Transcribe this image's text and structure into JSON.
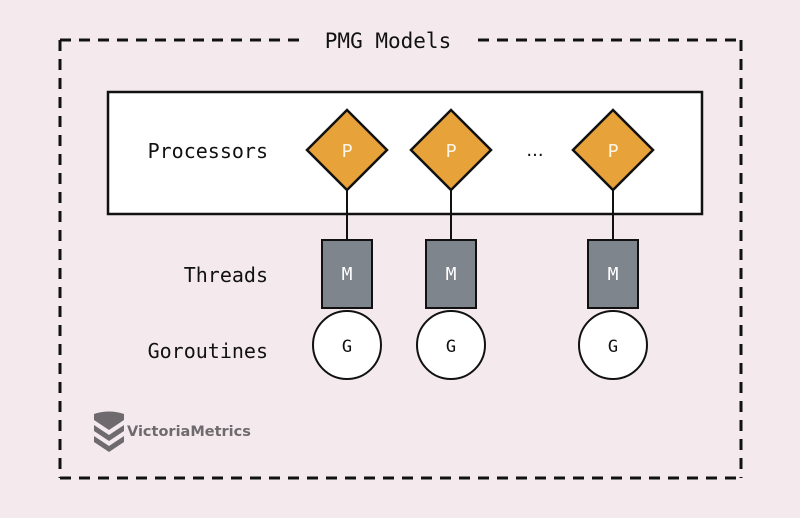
{
  "diagram": {
    "title": "PMG Models",
    "rows": {
      "processors": "Processors",
      "threads": "Threads",
      "goroutines": "Goroutines"
    },
    "columns": [
      {
        "processor": "P",
        "thread": "M",
        "goroutine": "G"
      },
      {
        "processor": "P",
        "thread": "M",
        "goroutine": "G"
      },
      {
        "processor": "P",
        "thread": "M",
        "goroutine": "G"
      }
    ],
    "ellipsis": "...",
    "colors": {
      "background": "#f4eaee",
      "processor_fill": "#e8a23a",
      "thread_fill": "#7e858d",
      "goroutine_fill": "#ffffff",
      "stroke": "#111111"
    }
  },
  "logo": {
    "text": "VictoriaMetrics"
  }
}
